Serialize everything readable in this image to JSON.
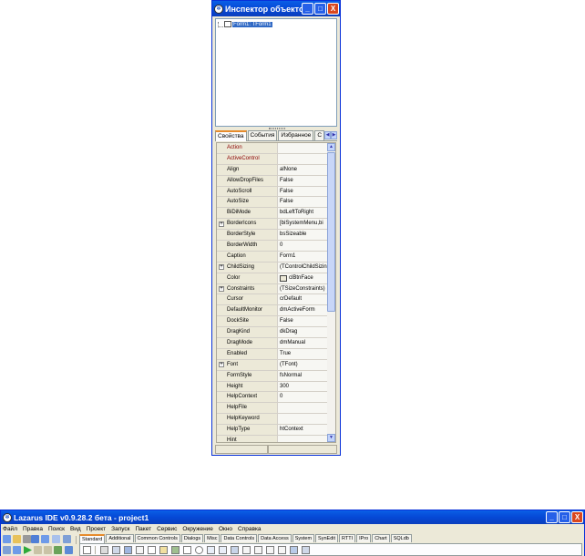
{
  "inspector": {
    "title": "Инспектор объектов",
    "window_buttons": {
      "minimize": "_",
      "maximize": "□",
      "close": "X"
    },
    "tree_root": "Form1: TForm1",
    "tabs": [
      {
        "label": "Свойства",
        "active": true
      },
      {
        "label": "События",
        "active": false
      },
      {
        "label": "Избранное",
        "active": false
      },
      {
        "label": "С",
        "active": false
      }
    ],
    "properties": [
      {
        "name": "Action",
        "value": "",
        "expandable": false,
        "event": true
      },
      {
        "name": "ActiveControl",
        "value": "",
        "expandable": false,
        "event": true
      },
      {
        "name": "Align",
        "value": "alNone",
        "expandable": false
      },
      {
        "name": "AllowDropFiles",
        "value": "False",
        "expandable": false
      },
      {
        "name": "AutoScroll",
        "value": "False",
        "expandable": false
      },
      {
        "name": "AutoSize",
        "value": "False",
        "expandable": false
      },
      {
        "name": "BiDiMode",
        "value": "bdLeftToRight",
        "expandable": false
      },
      {
        "name": "BorderIcons",
        "value": "[biSystemMenu,bi",
        "expandable": true
      },
      {
        "name": "BorderStyle",
        "value": "bsSizeable",
        "expandable": false
      },
      {
        "name": "BorderWidth",
        "value": "0",
        "expandable": false
      },
      {
        "name": "Caption",
        "value": "Form1",
        "expandable": false
      },
      {
        "name": "ChildSizing",
        "value": "(TControlChildSizin",
        "expandable": true
      },
      {
        "name": "Color",
        "value": "clBtnFace",
        "expandable": false,
        "swatch": true
      },
      {
        "name": "Constraints",
        "value": "(TSizeConstraints)",
        "expandable": true
      },
      {
        "name": "Cursor",
        "value": "crDefault",
        "expandable": false
      },
      {
        "name": "DefaultMonitor",
        "value": "dmActiveForm",
        "expandable": false
      },
      {
        "name": "DockSite",
        "value": "False",
        "expandable": false
      },
      {
        "name": "DragKind",
        "value": "dkDrag",
        "expandable": false
      },
      {
        "name": "DragMode",
        "value": "dmManual",
        "expandable": false
      },
      {
        "name": "Enabled",
        "value": "True",
        "expandable": false
      },
      {
        "name": "Font",
        "value": "(TFont)",
        "expandable": true
      },
      {
        "name": "FormStyle",
        "value": "fsNormal",
        "expandable": false
      },
      {
        "name": "Height",
        "value": "300",
        "expandable": false
      },
      {
        "name": "HelpContext",
        "value": "0",
        "expandable": false
      },
      {
        "name": "HelpFile",
        "value": "",
        "expandable": false
      },
      {
        "name": "HelpKeyword",
        "value": "",
        "expandable": false
      },
      {
        "name": "HelpType",
        "value": "htContext",
        "expandable": false
      },
      {
        "name": "Hint",
        "value": "",
        "expandable": false
      }
    ]
  },
  "ide": {
    "title": "Lazarus IDE v0.9.28.2 бета - project1",
    "menu": [
      "Файл",
      "Правка",
      "Поиск",
      "Вид",
      "Проект",
      "Запуск",
      "Пакет",
      "Сервис",
      "Окружение",
      "Окно",
      "Справка"
    ],
    "palette_tabs": [
      "Standard",
      "Additional",
      "Common Controls",
      "Dialogs",
      "Misc",
      "Data Controls",
      "Data Access",
      "System",
      "SynEdit",
      "RTTI",
      "IPro",
      "Chart",
      "SQLdb"
    ],
    "active_palette_tab": "Standard"
  },
  "colors": {
    "titlebar": "#0548d6",
    "selection": "#316ac5",
    "event_text": "#8b0000",
    "tab_accent": "#e68b2c",
    "close_button": "#d9471f"
  }
}
